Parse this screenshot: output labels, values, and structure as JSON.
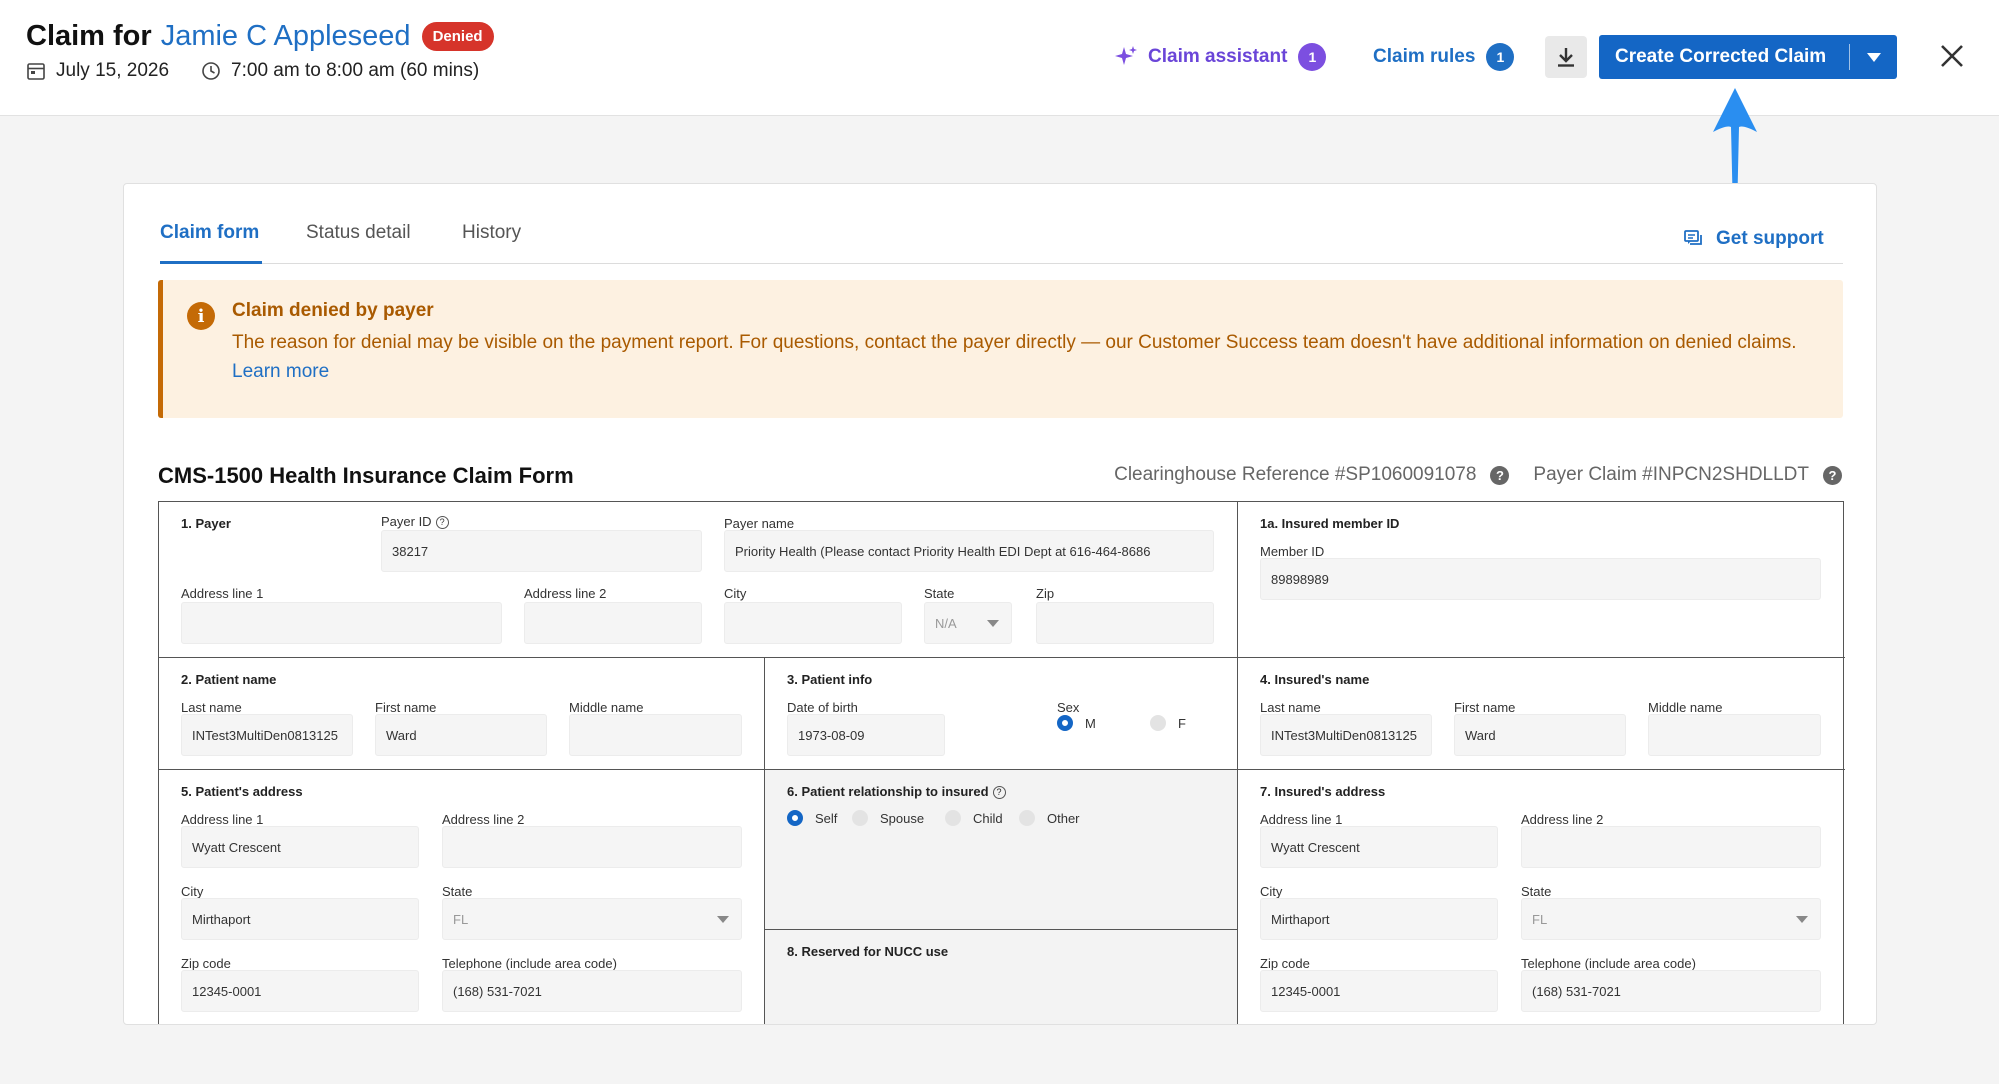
{
  "header": {
    "title_prefix": "Claim for",
    "patient_name": "Jamie C Appleseed",
    "status_badge": "Denied",
    "date": "July 15, 2026",
    "time": "7:00 am to 8:00 am (60 mins)",
    "claim_assistant_label": "Claim assistant",
    "claim_assistant_count": "1",
    "claim_rules_label": "Claim rules",
    "claim_rules_count": "1",
    "create_button_label": "Create Corrected Claim"
  },
  "colors": {
    "primary": "#1466c5",
    "assistant": "#7c4fe0",
    "denied": "#d6342a",
    "alert_text": "#a95a00",
    "alert_bg": "#fdf1e1"
  },
  "tabs": [
    {
      "label": "Claim form"
    },
    {
      "label": "Status detail"
    },
    {
      "label": "History"
    }
  ],
  "support_label": "Get support",
  "alert": {
    "title": "Claim denied by payer",
    "text": "The reason for denial may be visible on the payment report. For questions, contact the payer directly — our Customer Success team doesn't have additional information on denied claims.",
    "link": "Learn more"
  },
  "form": {
    "title": "CMS-1500 Health Insurance Claim Form",
    "clearinghouse_ref": "Clearinghouse Reference #SP1060091078",
    "payer_claim": "Payer Claim #INPCN2SHDLLDT",
    "payer": {
      "title": "1. Payer",
      "payer_id_label": "Payer ID",
      "payer_id": "38217",
      "payer_name_label": "Payer name",
      "payer_name": "Priority Health (Please contact Priority Health EDI Dept at 616-464-8686",
      "address1_label": "Address line 1",
      "address1": "",
      "address2_label": "Address line 2",
      "address2": "",
      "city_label": "City",
      "city": "",
      "state_label": "State",
      "state": "N/A",
      "zip_label": "Zip",
      "zip": ""
    },
    "insured_member": {
      "title": "1a. Insured member ID",
      "member_id_label": "Member ID",
      "member_id": "89898989"
    },
    "patient_name": {
      "title": "2. Patient name",
      "last_label": "Last name",
      "last": "INTest3MultiDen0813125",
      "first_label": "First name",
      "first": "Ward",
      "middle_label": "Middle name",
      "middle": ""
    },
    "patient_info": {
      "title": "3. Patient info",
      "dob_label": "Date of birth",
      "dob": "1973-08-09",
      "sex_label": "Sex",
      "sex_m": "M",
      "sex_f": "F"
    },
    "insured_name": {
      "title": "4. Insured's name",
      "last_label": "Last name",
      "last": "INTest3MultiDen0813125",
      "first_label": "First name",
      "first": "Ward",
      "middle_label": "Middle name",
      "middle": ""
    },
    "patient_address": {
      "title": "5. Patient's address",
      "address1_label": "Address line 1",
      "address1": "Wyatt Crescent",
      "address2_label": "Address line 2",
      "address2": "",
      "city_label": "City",
      "city": "Mirthaport",
      "state_label": "State",
      "state": "FL",
      "zip_label": "Zip code",
      "zip": "12345-0001",
      "phone_label": "Telephone (include area code)",
      "phone": "(168) 531-7021"
    },
    "relationship": {
      "title": "6. Patient relationship to insured",
      "options": [
        "Self",
        "Spouse",
        "Child",
        "Other"
      ]
    },
    "reserved": {
      "title": "8. Reserved for NUCC use"
    },
    "insured_address": {
      "title": "7. Insured's address",
      "address1_label": "Address line 1",
      "address1": "Wyatt Crescent",
      "address2_label": "Address line 2",
      "address2": "",
      "city_label": "City",
      "city": "Mirthaport",
      "state_label": "State",
      "state": "FL",
      "zip_label": "Zip code",
      "zip": "12345-0001",
      "phone_label": "Telephone (include area code)",
      "phone": "(168) 531-7021"
    }
  }
}
